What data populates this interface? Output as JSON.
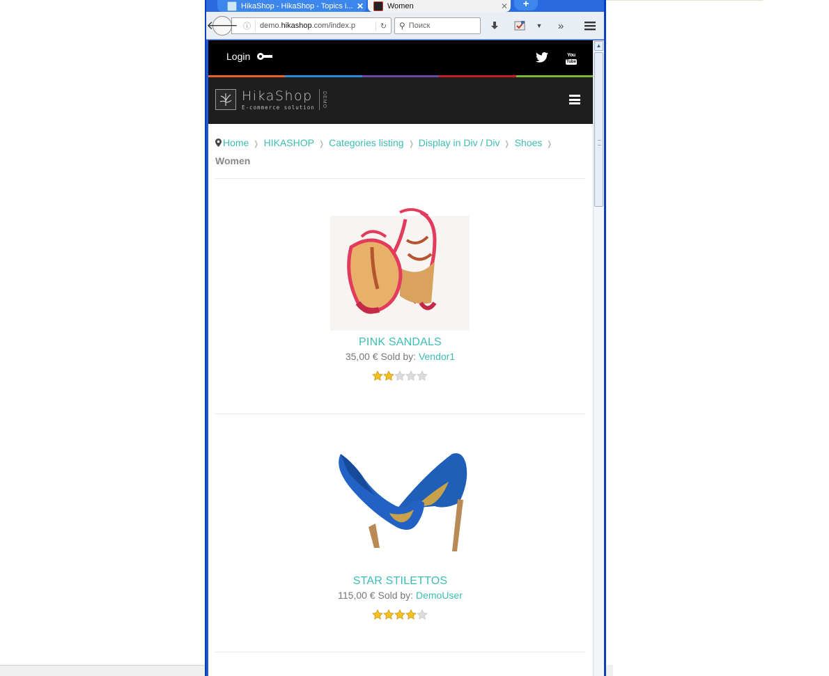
{
  "browser": {
    "tabs": [
      {
        "title": "HikaShop - HikaShop - Topics i...",
        "active": true
      },
      {
        "title": "Women",
        "active": false
      }
    ],
    "new_tab_label": "+",
    "url_domain_prefix": "demo.",
    "url_domain": "hikashop",
    "url_domain_suffix": ".com/index.p",
    "search_placeholder": "Поиск",
    "icons": [
      "back-arrow-icon",
      "info-icon",
      "reload-icon",
      "search-icon",
      "download-icon",
      "pocket-icon",
      "dropdown-icon",
      "overflow-icon",
      "menu-icon"
    ]
  },
  "site": {
    "topbar": {
      "login_label": "Login",
      "social": [
        "twitter-icon",
        "youtube-icon"
      ],
      "youtube_top": "You",
      "youtube_bottom": "Tube"
    },
    "colorbar": [
      "#e8632d",
      "#2b8ad6",
      "#6a4aa3",
      "#c41e27",
      "#78b833"
    ],
    "logo": {
      "name": "HikaShop",
      "tagline": "E-commerce solution",
      "badge": "DEMO"
    },
    "accent_color": "#3bbdb2"
  },
  "breadcrumb": {
    "items": [
      "Home",
      "HIKASHOP",
      "Categories listing",
      "Display in Div / Div",
      "Shoes"
    ],
    "current": "Women"
  },
  "products": [
    {
      "name": "PINK SANDALS",
      "price": "35,00 €",
      "sold_by_label": "Sold by:",
      "vendor": "Vendor1",
      "rating": 2,
      "rating_max": 5,
      "image": "pink-sandals-image"
    },
    {
      "name": "STAR STILETTOS",
      "price": "115,00 €",
      "sold_by_label": "Sold by:",
      "vendor": "DemoUser",
      "rating": 4,
      "rating_max": 5,
      "image": "blue-stilettos-image"
    }
  ]
}
